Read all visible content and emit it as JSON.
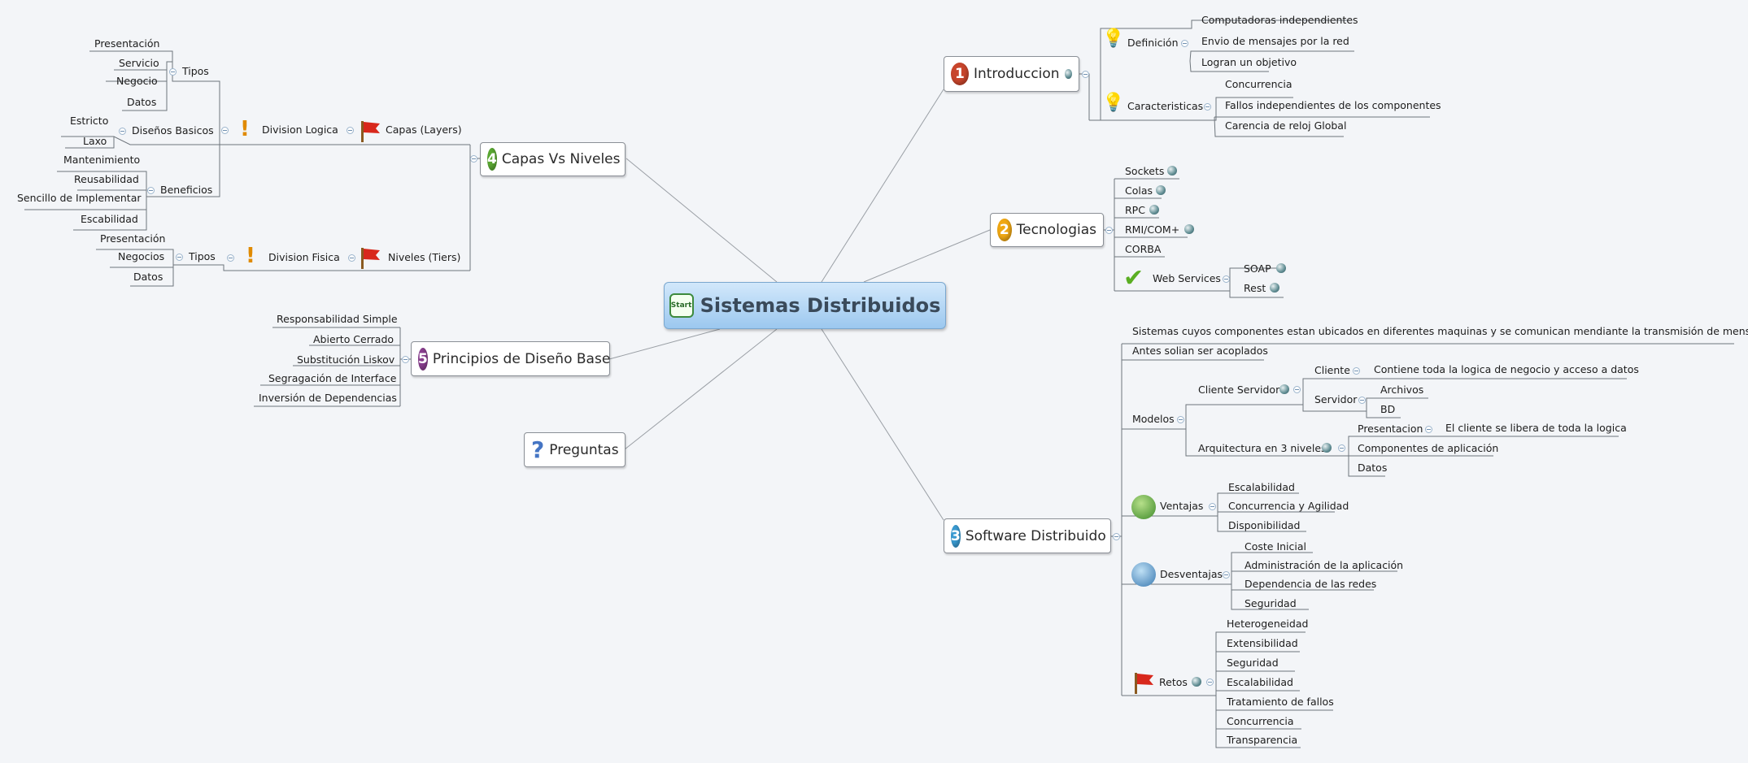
{
  "central": {
    "icon_text": "Start",
    "title": "Sistemas Distribuidos"
  },
  "intro": {
    "title": "Introduccion",
    "num": "1",
    "definicion": {
      "label": "Definición",
      "items": [
        "Computadoras independientes",
        "Envio de mensajes por la red",
        "Logran un objetivo"
      ]
    },
    "caracteristicas": {
      "label": "Caracteristicas",
      "items": [
        "Concurrencia",
        "Fallos independientes de los componentes",
        "Carencia de reloj Global"
      ]
    }
  },
  "tecnologias": {
    "title": "Tecnologias",
    "num": "2",
    "items": [
      "Sockets",
      "Colas",
      "RPC",
      "RMI/COM+",
      "CORBA"
    ],
    "web_services": {
      "label": "Web Services",
      "items": [
        "SOAP",
        "Rest"
      ]
    }
  },
  "software": {
    "title": "Software Distribuido",
    "num": "3",
    "sistemas": "Sistemas cuyos componentes estan ubicados en diferentes maquinas y se comunican mendiante la transmisión de mensajes",
    "antes": "Antes solian ser acoplados",
    "modelos": {
      "label": "Modelos",
      "cliente_servidor": {
        "label": "Cliente Servidor",
        "cliente": {
          "label": "Cliente",
          "desc": "Contiene toda la logica de negocio y acceso a datos"
        },
        "servidor": {
          "label": "Servidor",
          "items": [
            "Archivos",
            "BD"
          ]
        }
      },
      "tres_niveles": {
        "label": "Arquitectura en 3 niveles",
        "presentacion": {
          "label": "Presentacion",
          "desc": "El cliente se libera de toda la logica"
        },
        "items": [
          "Componentes de aplicación",
          "Datos"
        ]
      }
    },
    "ventajas": {
      "label": "Ventajas",
      "items": [
        "Escalabilidad",
        "Concurrencia y Agilidad",
        "Disponibilidad"
      ]
    },
    "desventajas": {
      "label": "Desventajas",
      "items": [
        "Coste Inicial",
        "Administración de la aplicación",
        "Dependencia de las redes",
        "Seguridad"
      ]
    },
    "retos": {
      "label": "Retos",
      "items": [
        "Heterogeneidad",
        "Extensibilidad",
        "Seguridad",
        "Escalabilidad",
        "Tratamiento de fallos",
        "Concurrencia",
        "Transparencia"
      ]
    }
  },
  "capas": {
    "title": "Capas Vs Niveles",
    "num": "4",
    "layers": {
      "label": "Capas (Layers)",
      "division_logica": {
        "label": "Division Logica",
        "tipos": {
          "label": "Tipos",
          "items": [
            "Presentación",
            "Servicio",
            "Negocio",
            "Datos"
          ]
        },
        "disenos": {
          "label": "Diseños Basicos",
          "items": [
            "Estricto",
            "Laxo"
          ]
        },
        "beneficios": {
          "label": "Beneficios",
          "items": [
            "Mantenimiento",
            "Reusabilidad",
            "Sencillo de Implementar",
            "Escabilidad"
          ]
        }
      }
    },
    "tiers": {
      "label": "Niveles (Tiers)",
      "division_fisica": {
        "label": "Division Fisica",
        "tipos": {
          "label": "Tipos",
          "items": [
            "Presentación",
            "Negocios",
            "Datos"
          ]
        }
      }
    }
  },
  "principios": {
    "title": "Principios de Diseño Base",
    "num": "5",
    "items": [
      "Responsabilidad Simple",
      "Abierto Cerrado",
      "Substitución Liskov",
      "Segragación de Interface",
      "Inversión de Dependencias"
    ]
  },
  "preguntas": {
    "title": "Preguntas"
  },
  "colors": {
    "central_top": "#d2e8fb",
    "central_bottom": "#9cc8ef",
    "line": "#6e757c",
    "num1": "#c8452c",
    "num2": "#f0a814",
    "num3": "#3a9bd2",
    "num4": "#5aa832",
    "num5": "#8a3f8f"
  }
}
